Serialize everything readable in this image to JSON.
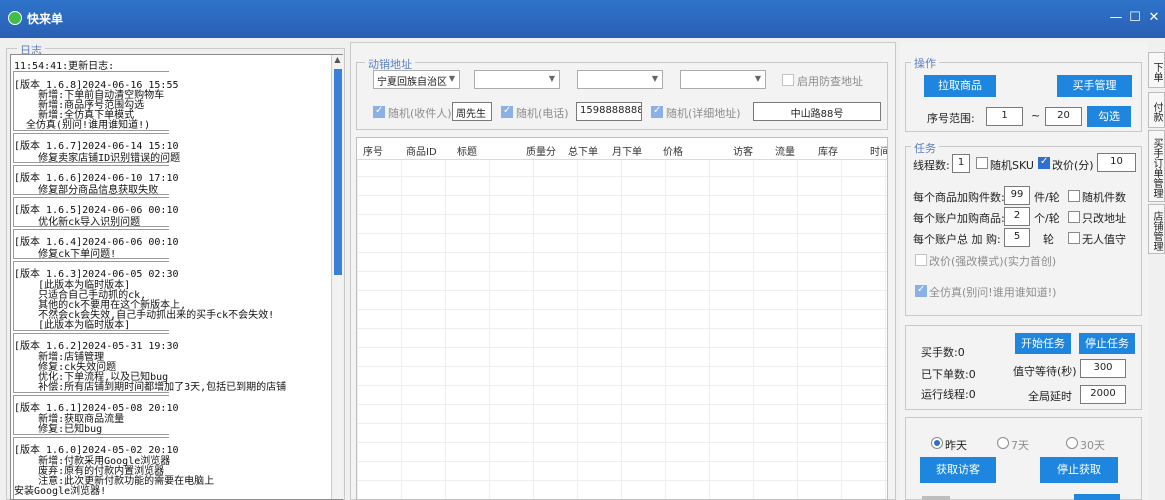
{
  "window": {
    "title": "快来单",
    "minimize": "—",
    "maximize": "☐",
    "close": "✕"
  },
  "log": {
    "legend": "日志",
    "lines": [
      "11:54:41:更新日志:",
      "[版本 1.6.8]2024-06-16 15:55",
      "    新增:下单前自动清空购物车",
      "    新增:商品序号范围勾选",
      "    新增:全仿真下单模式",
      "  全仿真(别问!谁用谁知道!)",
      "[版本 1.6.7]2024-06-14 15:10",
      "    修复卖家店铺ID识别错误的问题",
      "[版本 1.6.6]2024-06-10 17:10",
      "    修复部分商品信息获取失败",
      "[版本 1.6.5]2024-06-06 00:10",
      "    优化新ck导入识别问题",
      "[版本 1.6.4]2024-06-06 00:10",
      "    修复ck下单问题!",
      "[版本 1.6.3]2024-06-05 02:30",
      "    [此版本为临时版本]",
      "    只适合自己手动抓的ck,",
      "    其他的ck不要用在这个新版本上,",
      "    不然会ck会失效,自己手动抓出来的买手ck不会失效!",
      "    [此版本为临时版本]",
      "[版本 1.6.2]2024-05-31 19:30",
      "    新增:店铺管理",
      "    修复:ck失效问题",
      "    优化:下单流程,以及已知bug",
      "    补偿:所有店铺到期时间都增加了3天,包括已到期的店铺",
      "[版本 1.6.1]2024-05-08 20:10",
      "    新增:获取商品流量",
      "    修复:已知bug",
      "[版本 1.6.0]2024-05-02 20:10",
      "    新增:付款采用Google浏览器",
      "    废弃:原有的付款内置浏览器",
      "    注意:此次更新付款功能的需要在电脑上",
      "安装Google浏览器!"
    ]
  },
  "address": {
    "legend": "动销地址",
    "province": "宁夏回族自治区",
    "city": "",
    "district": "",
    "street": "",
    "anti_check_label": "启用防查地址",
    "random_receiver_label": "随机(收件人)",
    "receiver_value": "周先生",
    "random_phone_label": "随机(电话)",
    "phone_value": "15988888888",
    "random_detail_label": "随机(详细地址)",
    "detail_value": "中山路88号"
  },
  "table": {
    "columns": [
      "序号",
      "商品ID",
      "标题",
      "质量分",
      "总下单",
      "月下单",
      "价格",
      "访客",
      "流量",
      "库存",
      "时间"
    ]
  },
  "operations": {
    "legend": "操作",
    "fetch_button": "拉取商品",
    "buyer_button": "买手管理",
    "range_label": "序号范围:",
    "range_start": "1",
    "range_dash": "~",
    "range_end": "20",
    "check_button": "勾选"
  },
  "task": {
    "legend": "任务",
    "threads_label": "线程数:",
    "threads_value": "1",
    "random_sku_label": "随机SKU",
    "change_price_label": "改价(分)",
    "change_price_value": "10",
    "cart_count_label": "每个商品加购件数:",
    "cart_count_value": "99",
    "cart_count_unit": "件/轮",
    "random_count_label": "随机件数",
    "account_cart_label": "每个账户加购商品:",
    "account_cart_value": "2",
    "account_cart_unit": "个/轮",
    "only_address_label": "只改地址",
    "account_total_label": "每个账户总 加 购:",
    "account_total_value": "5",
    "account_total_unit": "轮",
    "unattended_label": "无人值守",
    "strong_change_label": "改价(强改模式)(实力首创)",
    "full_sim_label": "全仿真(别问!谁用谁知道!)"
  },
  "status": {
    "buyers_label": "买手数:0",
    "orders_label": "已下单数:0",
    "threads_running_label": "运行线程:0",
    "start_button": "开始任务",
    "stop_button": "停止任务",
    "pay_wait_label": "值守等待(秒)",
    "pay_wait_value": "300",
    "global_delay_label": "全局延时",
    "global_delay_value": "2000"
  },
  "visitors": {
    "yesterday_label": "昨天",
    "seven_days_label": "7天",
    "thirty_days_label": "30天",
    "fetch_button": "获取访客",
    "stop_button": "停止获取"
  },
  "side_tabs": [
    "下单",
    "付款",
    "买手订单管理",
    "店铺管理"
  ],
  "colors": {
    "titlebar": "#2a5fb4",
    "button": "#1f86e0",
    "legend": "#5a7fc4",
    "scroll_thumb": "#3a7fd8"
  }
}
